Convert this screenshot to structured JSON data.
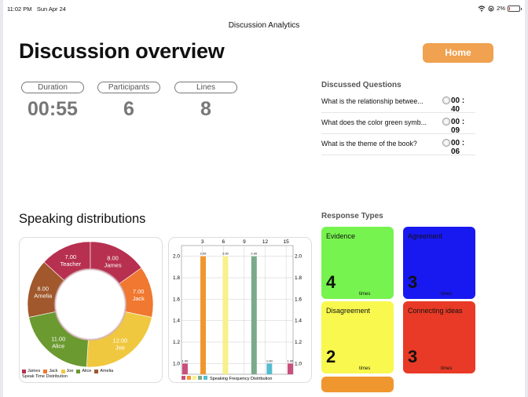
{
  "status": {
    "time": "11:02 PM",
    "date": "Sun Apr 24",
    "battery": "2%",
    "battery_level": 0.02
  },
  "nav": {
    "title": "Discussion Analytics"
  },
  "header": {
    "title": "Discussion overview",
    "home_label": "Home"
  },
  "stats": [
    {
      "label": "Duration",
      "value": "00:55"
    },
    {
      "label": "Participants",
      "value": "6"
    },
    {
      "label": "Lines",
      "value": "8"
    }
  ],
  "discussed": {
    "title": "Discussed Questions",
    "items": [
      {
        "question": "What is the relationship betwee...",
        "duration": "00 : 40"
      },
      {
        "question": "What does the color green symb...",
        "duration": "00 : 09"
      },
      {
        "question": "What is the theme of the book?",
        "duration": "00 : 06"
      }
    ]
  },
  "speaking": {
    "title": "Speaking distributions"
  },
  "colors": {
    "accent": "#f0a250",
    "james": "#b73050",
    "jack": "#f07830",
    "joe": "#f0c840",
    "alice": "#6a9a30",
    "amelia": "#a0582c"
  },
  "chart_data": [
    {
      "type": "pie",
      "title": "Speak Time Distribution",
      "slices": [
        {
          "name": "Teacher",
          "value": 7.0,
          "label": "7.00",
          "color": "#b73050"
        },
        {
          "name": "James",
          "value": 8.0,
          "label": "8.00",
          "color": "#b73050"
        },
        {
          "name": "Jack",
          "value": 7.0,
          "label": "7.00",
          "color": "#f07830"
        },
        {
          "name": "Joe",
          "value": 12.0,
          "label": "12.00",
          "color": "#f0c840"
        },
        {
          "name": "Alice",
          "value": 11.0,
          "label": "11.00",
          "color": "#6a9a30"
        },
        {
          "name": "Amelia",
          "value": 8.0,
          "label": "8.00",
          "color": "#a0582c"
        }
      ],
      "legend": [
        {
          "name": "James",
          "color": "#b73050"
        },
        {
          "name": "Jack",
          "color": "#f07830"
        },
        {
          "name": "Joe",
          "color": "#f0c840"
        },
        {
          "name": "Alice",
          "color": "#6a9a30"
        },
        {
          "name": "Amelia",
          "color": "#a0582c"
        }
      ],
      "legend_position": "bottom-left"
    },
    {
      "type": "bar",
      "title": "Speaking Frequency Distribution",
      "x_ticks": [
        "3",
        "6",
        "9",
        "12",
        "15"
      ],
      "xlim": [
        0,
        16
      ],
      "ylim": [
        0.9,
        2.1
      ],
      "y_ticks": [
        "1.0",
        "1.2",
        "1.4",
        "1.6",
        "1.8",
        "2.0"
      ],
      "bars": [
        {
          "x": 0.5,
          "value": 1.0,
          "label": "1.00",
          "color": "#c94f7c"
        },
        {
          "x": 3.1,
          "value": 2.0,
          "label": "2.00",
          "color": "#f0962e"
        },
        {
          "x": 6.3,
          "value": 2.0,
          "label": "2.00",
          "color": "#f8f08a"
        },
        {
          "x": 10.4,
          "value": 2.0,
          "label": "2.00",
          "color": "#7aaa8a"
        },
        {
          "x": 12.6,
          "value": 1.0,
          "label": "1.00",
          "color": "#56bcd0"
        },
        {
          "x": 15.6,
          "value": 1.0,
          "label": "1.00",
          "color": "#c94f7c"
        }
      ],
      "legend_colors": [
        "#c94f7c",
        "#f0962e",
        "#f8f08a",
        "#7aaa8a",
        "#56bcd0"
      ],
      "grid": true
    }
  ],
  "response_types": {
    "title": "Response Types",
    "items": [
      {
        "label": "Evidence",
        "count": "4",
        "unit": "times",
        "color": "#76f34e"
      },
      {
        "label": "Agreement",
        "count": "3",
        "unit": "times",
        "color": "#1818f0"
      },
      {
        "label": "Disagreement",
        "count": "2",
        "unit": "times",
        "color": "#f8f84e"
      },
      {
        "label": "Connecting ideas",
        "count": "3",
        "unit": "times",
        "color": "#e83a26"
      }
    ]
  }
}
